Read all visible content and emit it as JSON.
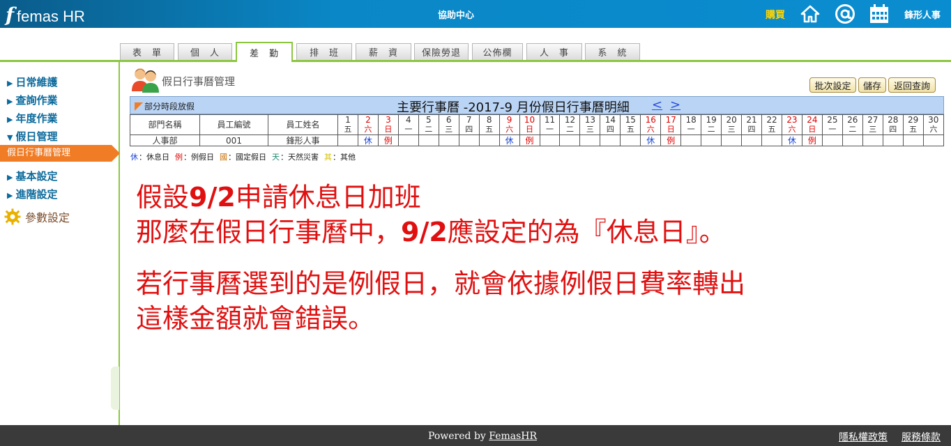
{
  "header": {
    "logo_mark": "f",
    "logo_text": "femas HR",
    "help_center": "協助中心",
    "buy": "購買",
    "icons": [
      "home-icon",
      "at-icon",
      "calendar-icon"
    ],
    "company": "鋒形人事"
  },
  "tabs": [
    {
      "label": "表　單"
    },
    {
      "label": "個　人"
    },
    {
      "label": "差　勤",
      "active": true
    },
    {
      "label": "排　班"
    },
    {
      "label": "薪　資"
    },
    {
      "label": "保險勞退"
    },
    {
      "label": "公佈欄"
    },
    {
      "label": "人　事"
    },
    {
      "label": "系　統"
    }
  ],
  "sidebar": {
    "items": [
      {
        "label": "日常維護",
        "arrow": "▶"
      },
      {
        "label": "查詢作業",
        "arrow": "▶"
      },
      {
        "label": "年度作業",
        "arrow": "▶"
      },
      {
        "label": "假日管理",
        "arrow": "▼"
      },
      {
        "label": "基本設定",
        "arrow": "▶"
      },
      {
        "label": "進階設定",
        "arrow": "▶"
      }
    ],
    "active_sub": "假日行事曆管理",
    "param": "參數設定"
  },
  "page": {
    "title": "假日行事曆管理",
    "buttons": {
      "batch": "批次設定",
      "save": "儲存",
      "back": "返回查詢"
    }
  },
  "calendar": {
    "partial_label": "部分時段放假",
    "title": "主要行事曆 -2017-9 月份假日行事曆明細",
    "prev": "<",
    "next": ">",
    "col_dept": "部門名稱",
    "col_id": "員工編號",
    "col_name": "員工姓名",
    "days": [
      {
        "d": "1",
        "w": "五"
      },
      {
        "d": "2",
        "w": "六",
        "red": true
      },
      {
        "d": "3",
        "w": "日",
        "red": true
      },
      {
        "d": "4",
        "w": "一"
      },
      {
        "d": "5",
        "w": "二"
      },
      {
        "d": "6",
        "w": "三"
      },
      {
        "d": "7",
        "w": "四"
      },
      {
        "d": "8",
        "w": "五"
      },
      {
        "d": "9",
        "w": "六",
        "red": true
      },
      {
        "d": "10",
        "w": "日",
        "red": true
      },
      {
        "d": "11",
        "w": "一"
      },
      {
        "d": "12",
        "w": "二"
      },
      {
        "d": "13",
        "w": "三"
      },
      {
        "d": "14",
        "w": "四"
      },
      {
        "d": "15",
        "w": "五"
      },
      {
        "d": "16",
        "w": "六",
        "red": true
      },
      {
        "d": "17",
        "w": "日",
        "red": true
      },
      {
        "d": "18",
        "w": "一"
      },
      {
        "d": "19",
        "w": "二"
      },
      {
        "d": "20",
        "w": "三"
      },
      {
        "d": "21",
        "w": "四"
      },
      {
        "d": "22",
        "w": "五"
      },
      {
        "d": "23",
        "w": "六",
        "red": true
      },
      {
        "d": "24",
        "w": "日",
        "red": true
      },
      {
        "d": "25",
        "w": "一"
      },
      {
        "d": "26",
        "w": "二"
      },
      {
        "d": "27",
        "w": "三"
      },
      {
        "d": "28",
        "w": "四"
      },
      {
        "d": "29",
        "w": "五"
      },
      {
        "d": "30",
        "w": "六"
      }
    ],
    "row": {
      "dept": "人事部",
      "id": "001",
      "name": "鋒形人事",
      "marks": [
        "",
        "休",
        "例",
        "",
        "",
        "",
        "",
        "",
        "休",
        "例",
        "",
        "",
        "",
        "",
        "",
        "休",
        "例",
        "",
        "",
        "",
        "",
        "",
        "休",
        "例",
        "",
        "",
        "",
        "",
        "",
        ""
      ]
    }
  },
  "legend": [
    {
      "key": "休",
      "text": "：休息日",
      "color": "#1a46d8"
    },
    {
      "key": "例",
      "text": "：例假日",
      "color": "#e00000"
    },
    {
      "key": "國",
      "text": "：國定假日",
      "color": "#c56b00"
    },
    {
      "key": "天",
      "text": "：天然災害",
      "color": "#1b8a6f"
    },
    {
      "key": "其",
      "text": "：其他",
      "color": "#d6c100"
    }
  ],
  "note": {
    "l1_a": "假設",
    "l1_b": "9/2",
    "l1_c": "申請休息日加班",
    "l2_a": "那麼在假日行事曆中，",
    "l2_b": "9/2",
    "l2_c": "應設定的為『休息日』。",
    "l3": "若行事曆選到的是例假日，就會依據例假日費率轉出",
    "l4": "這樣金額就會錯誤。"
  },
  "footer": {
    "powered_prefix": "Powered by ",
    "powered_link": "FemasHR",
    "privacy": "隱私權政策",
    "terms": "服務條款"
  }
}
